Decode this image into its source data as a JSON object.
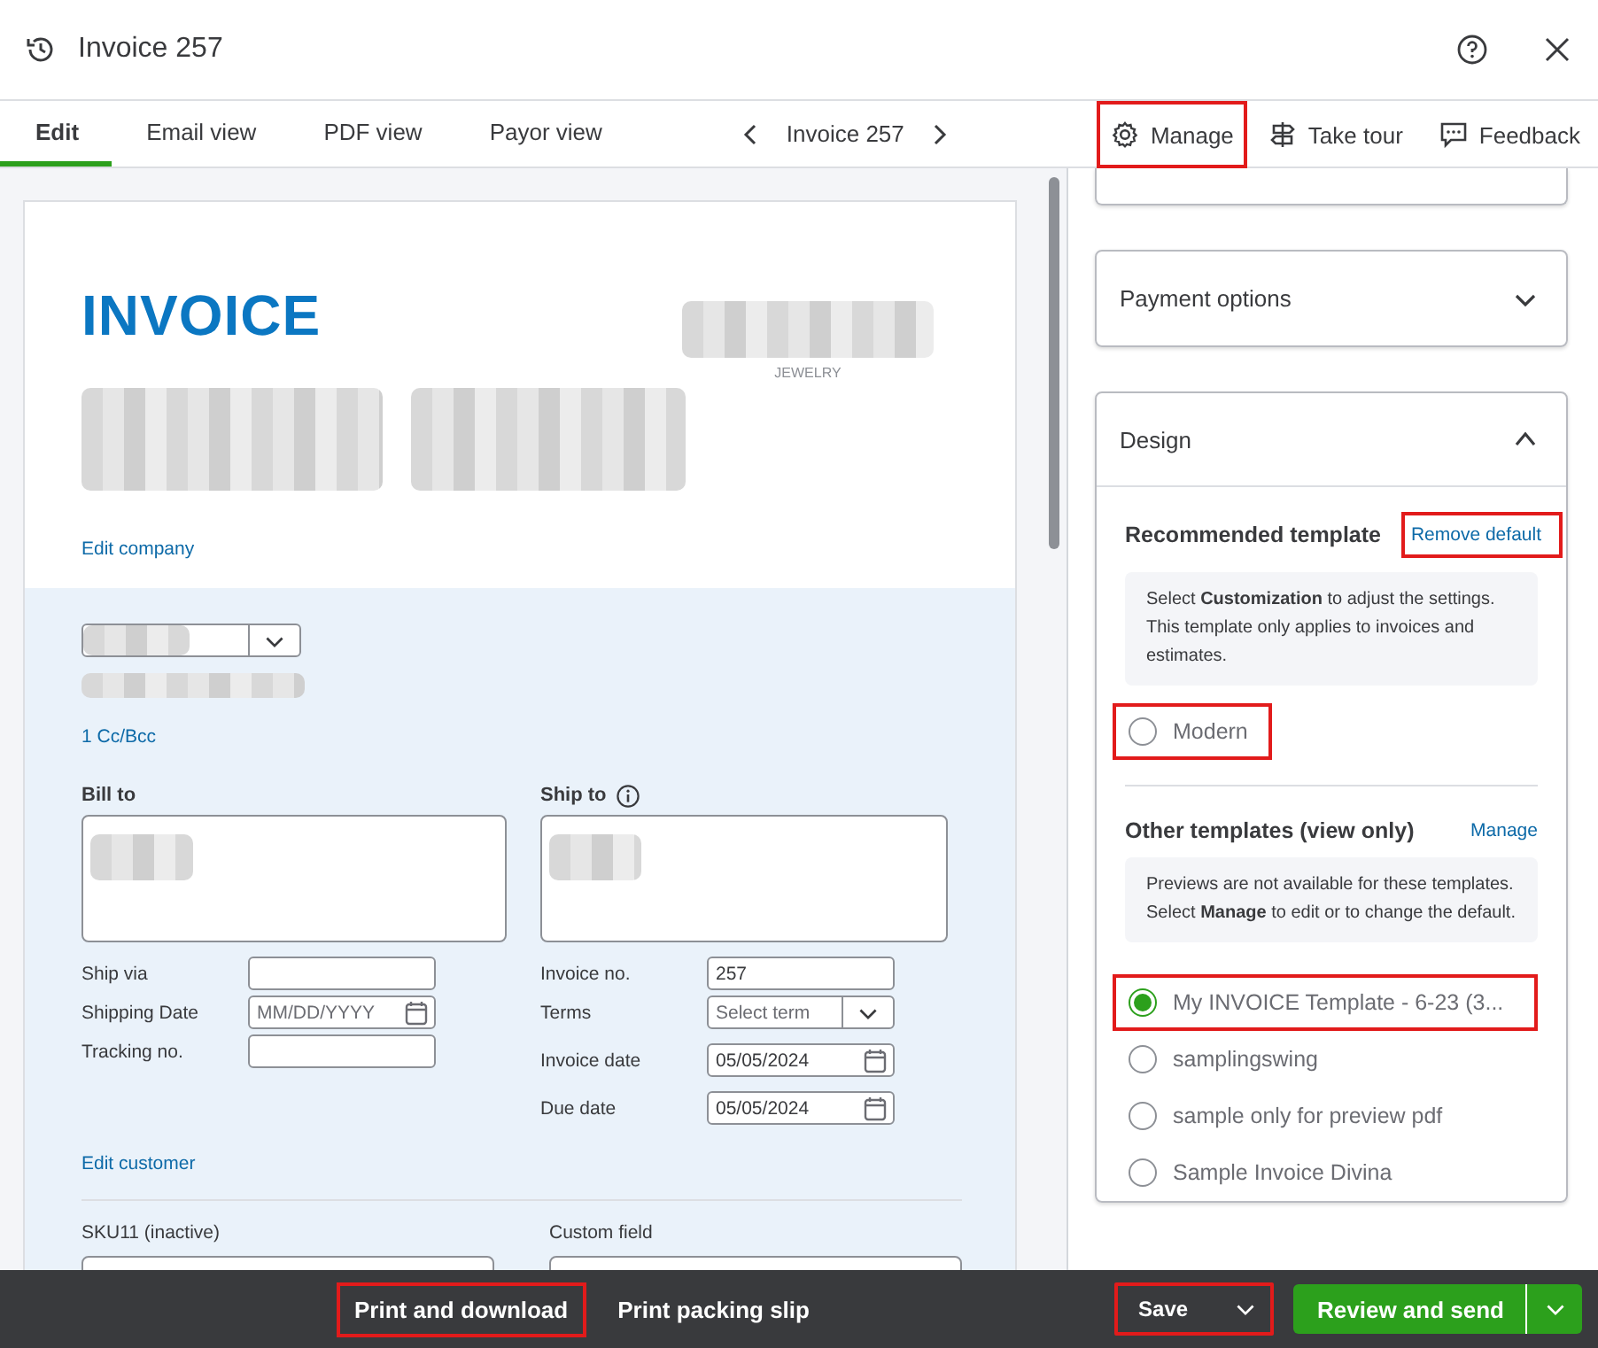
{
  "window": {
    "title": "Invoice 257"
  },
  "tabs": [
    {
      "label": "Edit",
      "selected": true
    },
    {
      "label": "Email view",
      "selected": false
    },
    {
      "label": "PDF view",
      "selected": false
    },
    {
      "label": "Payor view",
      "selected": false
    }
  ],
  "record_nav": {
    "label": "Invoice 257"
  },
  "toolbar": [
    {
      "label": "Manage",
      "highlighted": true
    },
    {
      "label": "Take tour",
      "highlighted": false
    },
    {
      "label": "Feedback",
      "highlighted": false
    }
  ],
  "invoice": {
    "title": "INVOICE",
    "logo_caption": "JEWELRY",
    "edit_company": "Edit company",
    "cc_bcc": "1 Cc/Bcc",
    "bill_to": "Bill to",
    "ship_to": "Ship to",
    "fields_left": [
      {
        "label": "Ship via",
        "kind": "text"
      },
      {
        "label": "Shipping Date",
        "kind": "date",
        "placeholder": "MM/DD/YYYY"
      },
      {
        "label": "Tracking no.",
        "kind": "text"
      }
    ],
    "fields_right": [
      {
        "label": "Invoice no.",
        "kind": "text",
        "value": "257"
      },
      {
        "label": "Terms",
        "kind": "select",
        "placeholder": "Select term"
      },
      {
        "label": "Invoice date",
        "kind": "date",
        "value": "05/05/2024"
      },
      {
        "label": "Due date",
        "kind": "date",
        "value": "05/05/2024"
      }
    ],
    "edit_customer": "Edit customer",
    "custom_fields": [
      {
        "label": "SKU11 (inactive)"
      },
      {
        "label": "Custom field"
      }
    ]
  },
  "side_panel": {
    "sections": [
      {
        "title": "Payment options",
        "expanded": false
      },
      {
        "title": "Design",
        "expanded": true
      }
    ],
    "design": {
      "recommended_label": "Recommended template",
      "remove_default": {
        "label": "Remove default",
        "highlighted": true
      },
      "recommended_note": "Select **Customization** to adjust the settings. This template only applies to invoices and estimates.",
      "recommended_templates": [
        {
          "label": "Modern",
          "selected": false,
          "highlighted": true
        }
      ],
      "other_label": "Other templates (view only)",
      "other_manage": "Manage",
      "other_note": "Previews are not available for these templates. Select **Manage** to edit or to change the default.",
      "other_templates": [
        {
          "label": "My INVOICE Template - 6-23 (3...",
          "selected": true,
          "highlighted": true
        },
        {
          "label": "samplingswing",
          "selected": false,
          "highlighted": false
        },
        {
          "label": "sample only for preview pdf",
          "selected": false,
          "highlighted": false
        },
        {
          "label": "Sample Invoice Divina",
          "selected": false,
          "highlighted": false
        }
      ]
    }
  },
  "footer": {
    "buttons": [
      {
        "label": "Print and download",
        "highlighted": true
      },
      {
        "label": "Print packing slip",
        "highlighted": false
      }
    ],
    "save": {
      "label": "Save",
      "highlighted": true
    },
    "primary": {
      "label": "Review and send"
    }
  }
}
